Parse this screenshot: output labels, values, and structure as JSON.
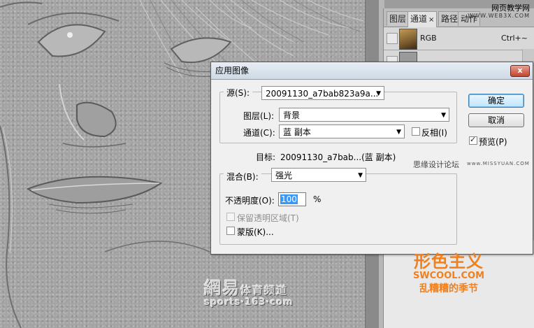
{
  "watermark_top": {
    "line1": "网页教学网",
    "line2": "WWW.WEB3X.COM"
  },
  "netease_watermark": {
    "line1_big": "網易",
    "line1_small": "体育频道",
    "line2": "sports·163·com"
  },
  "panel": {
    "tabs": [
      {
        "label": "图层"
      },
      {
        "label": "通道",
        "close": "×"
      },
      {
        "label": "路径"
      },
      {
        "label": "动作"
      }
    ],
    "channels": [
      {
        "name": "RGB",
        "shortcut": "Ctrl+~"
      }
    ]
  },
  "dialog": {
    "title": "应用图像",
    "close_label": "x",
    "source": {
      "label": "源(S):",
      "value": "20091130_a7bab823a9a...",
      "layer_label": "图层(L):",
      "layer_value": "背景",
      "channel_label": "通道(C):",
      "channel_value": "蓝 副本",
      "invert_label": "反相(I)"
    },
    "target": {
      "label": "目标:",
      "value": "20091130_a7bab...(蓝 副本)"
    },
    "blending": {
      "label": "混合(B):",
      "value": "强光",
      "opacity_label": "不透明度(O):",
      "opacity_value": "100",
      "opacity_unit": "%",
      "preserve_label": "保留透明区域(T)",
      "mask_label": "蒙版(K)..."
    },
    "buttons": {
      "ok": "确定",
      "cancel": "取消"
    },
    "preview": {
      "label": "预览(P)",
      "checked": true
    }
  },
  "missyuan_watermark": {
    "cn": "思缘设计论坛",
    "url": "www.MISSYUAN.COM"
  },
  "brand_watermark": {
    "line1": "形色主义",
    "line2": "SWCOOL.COM",
    "line3": "乱糟糟的季节"
  },
  "colors": {
    "brand_orange": "#f0801e",
    "close_red": "#c04530",
    "default_button": "#3c7fb1"
  }
}
